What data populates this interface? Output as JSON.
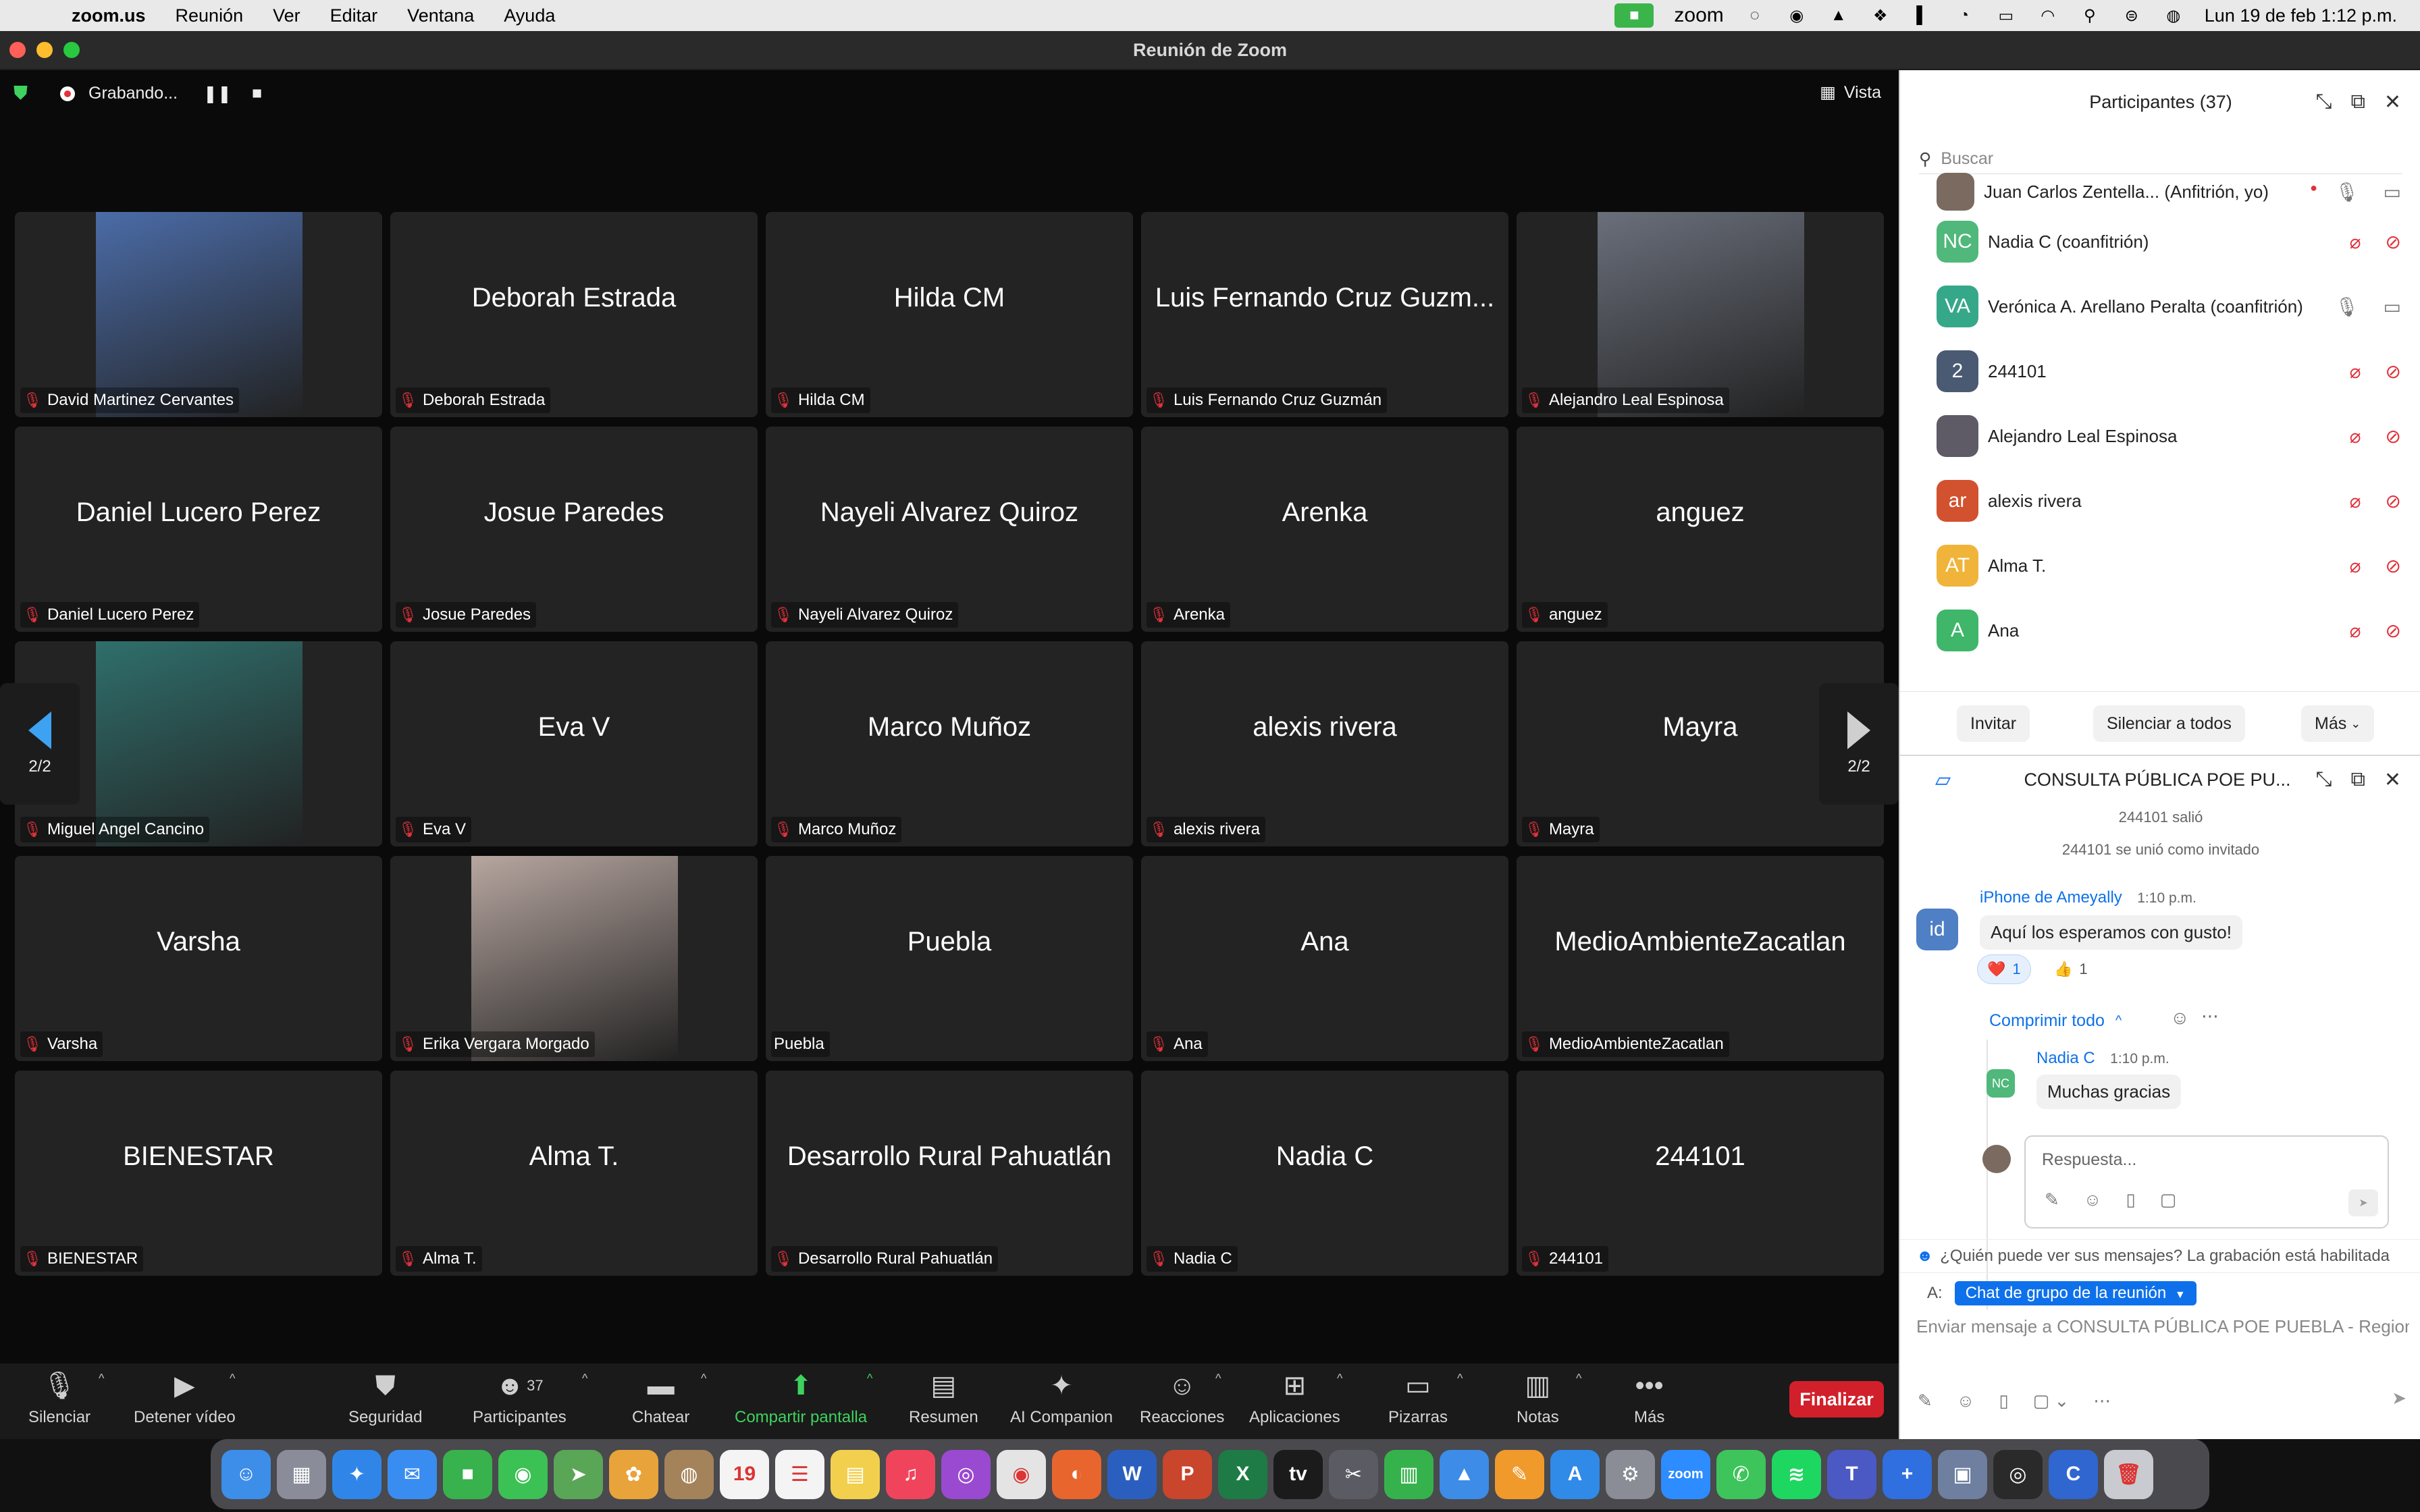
{
  "menubar": {
    "app": "zoom.us",
    "menus": [
      "Reunión",
      "Ver",
      "Editar",
      "Ventana",
      "Ayuda"
    ],
    "zoom_label": "zoom",
    "datetime": "Lun 19 de feb  1:12 p.m."
  },
  "window": {
    "title": "Reunión de Zoom"
  },
  "recording": {
    "label": "Grabando..."
  },
  "view_button": {
    "label": "Vista"
  },
  "pagination": {
    "prev": "2/2",
    "next": "2/2"
  },
  "tiles": [
    {
      "center": "",
      "label": "David Martinez Cervantes",
      "photo": true,
      "photo_color": "#4b6ca8"
    },
    {
      "center": "Deborah Estrada",
      "label": "Deborah Estrada"
    },
    {
      "center": "Hilda CM",
      "label": "Hilda CM"
    },
    {
      "center": "Luis Fernando Cruz Guzm...",
      "label": "Luis Fernando Cruz Guzmán"
    },
    {
      "center": "",
      "label": "Alejandro Leal Espinosa",
      "photo": true,
      "photo_color": "#6a6f7b"
    },
    {
      "center": "Daniel Lucero Perez",
      "label": "Daniel Lucero Perez"
    },
    {
      "center": "Josue Paredes",
      "label": "Josue Paredes"
    },
    {
      "center": "Nayeli Alvarez Quiroz",
      "label": "Nayeli Alvarez Quiroz"
    },
    {
      "center": "Arenka",
      "label": "Arenka"
    },
    {
      "center": "anguez",
      "label": "anguez"
    },
    {
      "center": "",
      "label": "Miguel Angel Cancino",
      "photo": true,
      "photo_color": "#2f6f6c"
    },
    {
      "center": "Eva V",
      "label": "Eva V"
    },
    {
      "center": "Marco Muñoz",
      "label": "Marco Muñoz"
    },
    {
      "center": "alexis rivera",
      "label": "alexis rivera"
    },
    {
      "center": "Mayra",
      "label": "Mayra"
    },
    {
      "center": "Varsha",
      "label": "Varsha"
    },
    {
      "center": "",
      "label": "Erika Vergara  Morgado",
      "photo": true,
      "photo_color": "#b7a6a0"
    },
    {
      "center": "Puebla",
      "label": "Puebla",
      "unmuted": true
    },
    {
      "center": "Ana",
      "label": "Ana"
    },
    {
      "center": "MedioAmbienteZacatlan",
      "label": "MedioAmbienteZacatlan"
    },
    {
      "center": "BIENESTAR",
      "label": "BIENESTAR"
    },
    {
      "center": "Alma T.",
      "label": "Alma T."
    },
    {
      "center": "Desarrollo Rural Pahuatlán",
      "label": "Desarrollo Rural Pahuatlán"
    },
    {
      "center": "Nadia C",
      "label": "Nadia C"
    },
    {
      "center": "244101",
      "label": "244101"
    }
  ],
  "toolbar": {
    "mute": "Silenciar",
    "video": "Detener vídeo",
    "security": "Seguridad",
    "participants": "Participantes",
    "participants_count": "37",
    "chat": "Chatear",
    "share": "Compartir pantalla",
    "summary": "Resumen",
    "ai": "AI Companion",
    "reactions": "Reacciones",
    "apps": "Aplicaciones",
    "whiteboards": "Pizarras",
    "notes": "Notas",
    "more": "Más",
    "end": "Finalizar"
  },
  "participants_panel": {
    "title": "Participantes (37)",
    "search_placeholder": "Buscar",
    "list": [
      {
        "name": "Juan Carlos Zentella...   (Anfitrión, yo)",
        "initials": "",
        "color": "#7a6a60",
        "muted": false
      },
      {
        "name": "Nadia C (coanfitrión)",
        "initials": "NC",
        "color": "#4fb87a",
        "muted": true
      },
      {
        "name": "Verónica A. Arellano Peralta (coanfitrión)",
        "initials": "VA",
        "color": "#36a88a",
        "muted": false
      },
      {
        "name": "244101",
        "initials": "2",
        "color": "#4a5a72",
        "muted": true
      },
      {
        "name": "Alejandro Leal Espinosa",
        "initials": "",
        "color": "#5e5a66",
        "muted": true
      },
      {
        "name": "alexis rivera",
        "initials": "ar",
        "color": "#d2512e",
        "muted": true
      },
      {
        "name": "Alma T.",
        "initials": "AT",
        "color": "#f0b43a",
        "muted": true
      },
      {
        "name": "Ana",
        "initials": "A",
        "color": "#3fb66a",
        "muted": true
      }
    ],
    "invite": "Invitar",
    "mute_all": "Silenciar a todos",
    "more": "Más"
  },
  "chat_panel": {
    "title": "CONSULTA PÚBLICA POE PU...",
    "system_1": "244101 salió",
    "system_2": "244101 se unió como invitado",
    "msg1": {
      "sender": "iPhone de Ameyally",
      "time": "1:10 p.m.",
      "text": "Aquí los esperamos con gusto!",
      "avatar": "id"
    },
    "reactions": [
      {
        "emoji": "❤️",
        "count": "1"
      },
      {
        "emoji": "👍",
        "count": "1"
      }
    ],
    "collapse": "Comprimir todo",
    "reply": {
      "sender": "Nadia C",
      "time": "1:10 p.m.",
      "text": "Muchas gracias",
      "avatar": "NC"
    },
    "reply_placeholder": "Respuesta...",
    "who_can_see": "¿Quién puede ver sus mensajes? La grabación está habilitada",
    "to_label": "A:",
    "to_target": "Chat de grupo de la reunión",
    "compose_placeholder": "Enviar mensaje a CONSULTA PÚBLICA POE PUEBLA - Region..."
  },
  "dock": {
    "apps": [
      {
        "name": "finder-icon",
        "color": "#3d8ee8",
        "glyph": "☺"
      },
      {
        "name": "launchpad-icon",
        "color": "#8a8d99",
        "glyph": "▦"
      },
      {
        "name": "safari-icon",
        "color": "#2f86e8",
        "glyph": "✦"
      },
      {
        "name": "mail-icon",
        "color": "#3a8df0",
        "glyph": "✉"
      },
      {
        "name": "facetime-icon",
        "color": "#38b24c",
        "glyph": "■"
      },
      {
        "name": "messages-icon",
        "color": "#3cc154",
        "glyph": "◉"
      },
      {
        "name": "maps-icon",
        "color": "#5aa657",
        "glyph": "➤"
      },
      {
        "name": "photos-icon",
        "color": "#e8a33a",
        "glyph": "✿"
      },
      {
        "name": "contacts-icon",
        "color": "#a5835a",
        "glyph": "◍"
      },
      {
        "name": "calendar-icon",
        "color": "#f4f4f4",
        "glyph": "19"
      },
      {
        "name": "reminders-icon",
        "color": "#f4f4f4",
        "glyph": "☰"
      },
      {
        "name": "notes-icon",
        "color": "#f2d04e",
        "glyph": "▤"
      },
      {
        "name": "music-icon",
        "color": "#f0445c",
        "glyph": "♫"
      },
      {
        "name": "podcasts-icon",
        "color": "#9a4ad0",
        "glyph": "◎"
      },
      {
        "name": "chrome-icon",
        "color": "#e4e4e4",
        "glyph": "◉"
      },
      {
        "name": "firefox-icon",
        "color": "#e8662e",
        "glyph": "◐"
      },
      {
        "name": "word-icon",
        "color": "#2b5fbf",
        "glyph": "W"
      },
      {
        "name": "powerpoint-icon",
        "color": "#c9452b",
        "glyph": "P"
      },
      {
        "name": "excel-icon",
        "color": "#1e7b45",
        "glyph": "X"
      },
      {
        "name": "appletv-icon",
        "color": "#1b1b1b",
        "glyph": "tv"
      },
      {
        "name": "finalcut-icon",
        "color": "#5b5b63",
        "glyph": "✂"
      },
      {
        "name": "numbers-icon",
        "color": "#36b24c",
        "glyph": "▥"
      },
      {
        "name": "keynote-icon",
        "color": "#3c8ce8",
        "glyph": "▲"
      },
      {
        "name": "pages-icon",
        "color": "#f09a2c",
        "glyph": "✎"
      },
      {
        "name": "appstore-icon",
        "color": "#2f8ae8",
        "glyph": "A"
      },
      {
        "name": "settings-icon",
        "color": "#8a8d96",
        "glyph": "⚙"
      },
      {
        "name": "zoom-icon",
        "color": "#2d8cff",
        "glyph": "zoom"
      },
      {
        "name": "whatsapp-icon",
        "color": "#3dc45a",
        "glyph": "✆"
      },
      {
        "name": "spotify-icon",
        "color": "#1ed760",
        "glyph": "≋"
      },
      {
        "name": "teams-icon",
        "color": "#4b59c4",
        "glyph": "T"
      },
      {
        "name": "meet-icon",
        "color": "#2f6fe0",
        "glyph": "+"
      },
      {
        "name": "preview-icon",
        "color": "#6e7fa0",
        "glyph": "▣"
      },
      {
        "name": "aperture-icon",
        "color": "#2a2a2a",
        "glyph": "◎"
      },
      {
        "name": "ccleaner-icon",
        "color": "#2f66d0",
        "glyph": "C"
      },
      {
        "name": "trash-icon",
        "color": "#c9cbd0",
        "glyph": "🗑"
      }
    ]
  }
}
